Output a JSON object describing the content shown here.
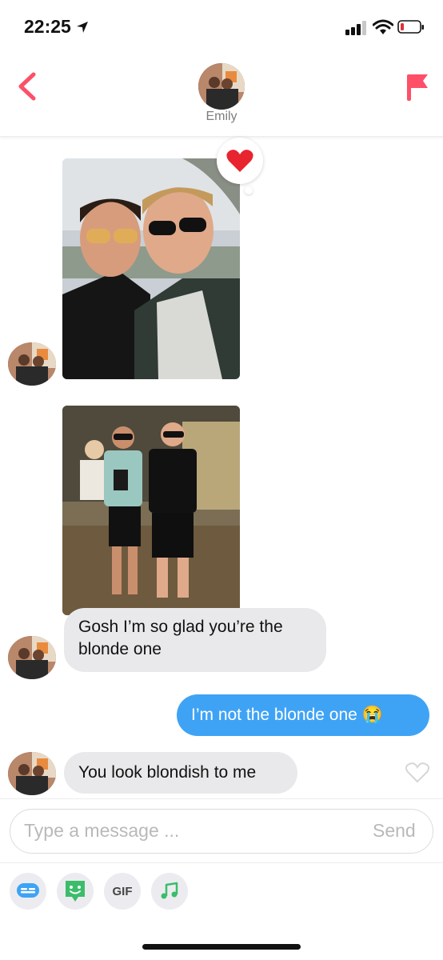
{
  "status": {
    "time": "22:25"
  },
  "header": {
    "contact_name": "Emily"
  },
  "messages": [
    {
      "type": "photo",
      "sender": "them",
      "reaction": "heart"
    },
    {
      "type": "photo",
      "sender": "them"
    },
    {
      "type": "text",
      "sender": "them",
      "text": "Gosh I’m so glad you’re the blonde one"
    },
    {
      "type": "text",
      "sender": "me",
      "text": "I’m not the blonde one 😭"
    },
    {
      "type": "text",
      "sender": "them",
      "text": "You look blondish to me"
    }
  ],
  "composer": {
    "placeholder": "Type a message ...",
    "send_label": "Send"
  },
  "toolbar": {
    "gif_label": "GIF"
  },
  "colors": {
    "accent": "#fd5068",
    "outgoing": "#3fa3f5",
    "incoming": "#e9e9eb"
  }
}
